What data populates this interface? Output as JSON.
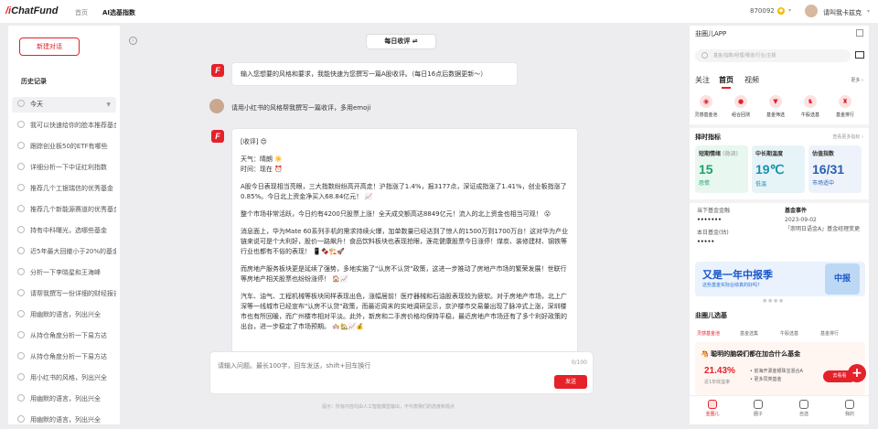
{
  "topbar": {
    "logo_prefix": "/i",
    "logo_text": "ChatFund",
    "nav": [
      "首页",
      "AI选基指数"
    ],
    "coins": "870092",
    "coin_symbol": "◆",
    "username": "请叫我卡兹克"
  },
  "sidebar": {
    "new_chat": "新建对话",
    "history_label": "历史记录",
    "items": [
      "今天",
      "我可以快速给你的脸本推荐基金吗？",
      "跟踪创业板50的ETF有哪些",
      "详细分析一下中证红利指数",
      "推荐几个工银瑞信的优秀基金",
      "推荐几个新能源赛道的优秀基金",
      "持有中科曙光，选哪些基金",
      "近5年最大回撤小于20%的基金",
      "分析一下李晓星和王海峰",
      "请帮我撰写一份详细的财经报告",
      "用幽默的语言，列出兴全",
      "从持仓角度分析一下易方达",
      "从持仓角度分析一下易方达",
      "用小红书的风格，列出兴全",
      "用幽默的语言，列出兴全",
      "用幽默的语言，列出兴全"
    ]
  },
  "main": {
    "topic": "每日收评",
    "topic_icon": "⇌",
    "bot_intro": "输入您想要的风格和要求，我能快速为您撰写一篇A股收评。（每日16点后数据更新～）",
    "user_msg": "请用小红书的风格帮我撰写一篇收评，多用emoji",
    "answer": [
      "[收评] 😍",
      "天气：晴朗 ☀️\n时间：现在 ⏰",
      "A股今日表现相当亮眼，三大指数纷纷高开高走！沪指涨了1.4%，报3177点，深证成指涨了1.41%，创业板指涨了0.85%。今日北上资金净买入68.84亿元！ 📈",
      "整个市场非常活跃，今日约有4200只股票上涨！全天成交额高达8849亿元！流入的北上资金也相当可观！ 😮",
      "消息面上，华为Mate 60系列手机的需求持续火爆，加单数量已经达到了惊人的1500万到1700万台！这对华为产业链来说可是个大利好，股价一路飙升！食品饮料板块也表现抢眼，莲花健康股票今日涨停！煤炭、装修建材、钢铁等行业也都有不俗的表现！ 📱🍫🏗️🚀",
      "而房地产服务板块更是延续了强势，多地实施了\"认房不认贷\"政策，这进一步推动了房地产市场的繁荣发展！世联行等房地产相关股票也纷纷涨停！ 🏠📈",
      "汽车、油气、工程机械等板块同样表现出色，涨幅居前！医疗器械和石油股表现较为疲软。对于房地产市场，北上广深等一线城市已经宣布\"认房不认贷\"政策，而最近周末的实地调研显示，京沪楼市交易量出现了脉冲式上涨，深圳楼市也有所回暖，而广州楼市相对平淡。此外，新房和二手房价格均保持平稳，最近房地产市场还有了多个利好政策的出台，进一步稳定了市场预期。 🏘️🏡📈💰"
    ],
    "input_placeholder": "请输入问题。最长100字，回车发送，shift+回车换行",
    "counter": "0/100",
    "send": "发送",
    "disclaimer": "提示：所有内容均由人工智能模型输出，不代表我们的态度和观点"
  },
  "right": {
    "title": "韭圈儿APP",
    "search_placeholder": "基金/指数/经理/赛道/行业/主题",
    "tabs": [
      "关注",
      "首页",
      "视频"
    ],
    "more": "更多 ›",
    "quick": [
      "灵感基金池",
      "组合回测",
      "基金筛选",
      "牛股选基",
      "基金排行"
    ],
    "indicator_title": "择时指标",
    "indicator_link": "查看更多指标 ›",
    "indicators": [
      {
        "t": "短期情绪",
        "tag": "(微调)",
        "v": "15",
        "s": "恐慌",
        "bg": "#e8f7f0",
        "c": "#1aa366"
      },
      {
        "t": "中长期温度",
        "tag": "",
        "v": "19℃",
        "s": "低温",
        "bg": "#e6f4f8",
        "c": "#1a8fb0"
      },
      {
        "t": "估值指数",
        "tag": "",
        "v": "16/31",
        "s": "市场适中",
        "bg": "#eef3fb",
        "c": "#2a5fb0"
      }
    ],
    "card_left": [
      "当下基金金融",
      "•••••••",
      "本日基金(估)",
      "•••••"
    ],
    "event_title": "基金事件",
    "event_date": "2023-09-02",
    "event_text": "「崇明日语金A」基金经理变更",
    "banner_big": "又是一年中报季",
    "banner_small": "这些基金实际业绩真的好吗？",
    "banner_pic": "中报",
    "section_title": "韭圈儿选基",
    "fund_tabs": [
      "灵感基金池",
      "基金选集",
      "牛股选基",
      "基金排行"
    ],
    "fund_card": {
      "headline": "🐴 聪明的脑袋们都在加合什么基金",
      "pct": "21.43%",
      "pct_label": "近1年收益率",
      "note1": "• 前海开源金银珠宝混合A",
      "note2": "• 更多同类基金",
      "buy": "去看看"
    },
    "fab": "+",
    "bottom_nav": [
      "韭圈儿",
      "圈子",
      "自选",
      "我的"
    ]
  }
}
